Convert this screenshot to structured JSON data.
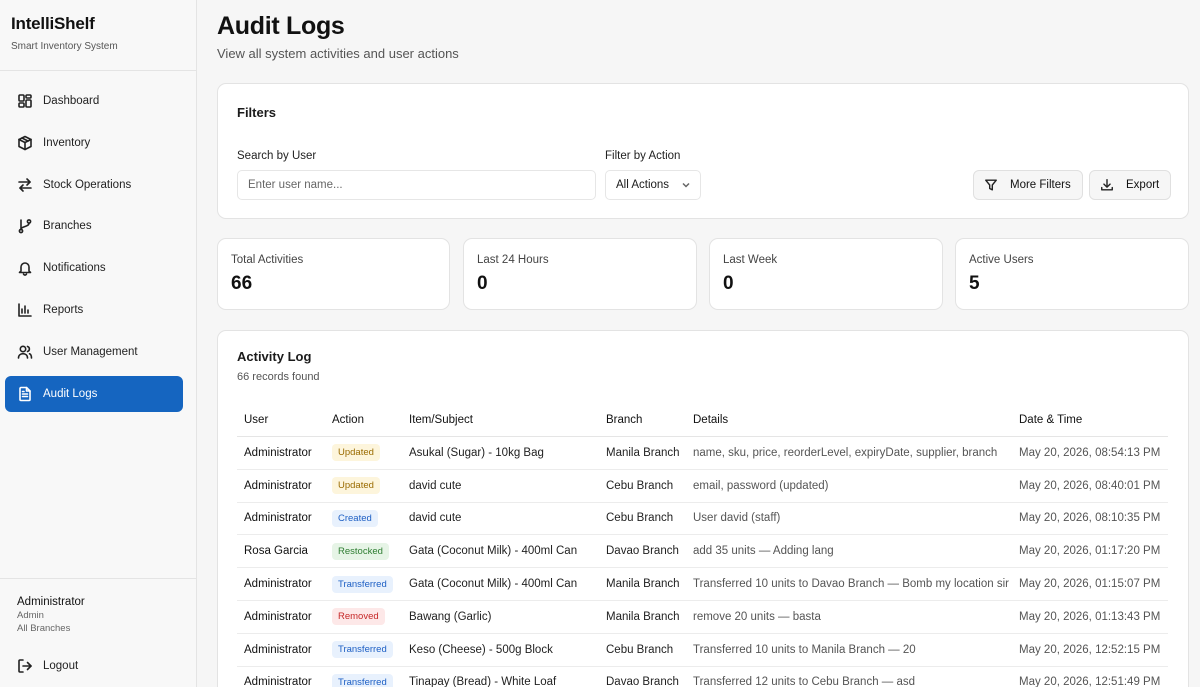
{
  "app": {
    "title": "IntelliShelf",
    "subtitle": "Smart Inventory System"
  },
  "sidebar": {
    "items": [
      {
        "label": "Dashboard",
        "icon": "dashboard-icon"
      },
      {
        "label": "Inventory",
        "icon": "box-icon"
      },
      {
        "label": "Stock Operations",
        "icon": "arrows-icon"
      },
      {
        "label": "Branches",
        "icon": "git-branch-icon"
      },
      {
        "label": "Notifications",
        "icon": "bell-icon"
      },
      {
        "label": "Reports",
        "icon": "bar-chart-icon"
      },
      {
        "label": "User Management",
        "icon": "users-icon"
      },
      {
        "label": "Audit Logs",
        "icon": "file-text-icon",
        "active": true
      }
    ],
    "user": {
      "name": "Administrator",
      "role": "Admin",
      "branch": "All Branches"
    },
    "logout_label": "Logout"
  },
  "header": {
    "title": "Audit Logs",
    "subtitle": "View all system activities and user actions"
  },
  "filters": {
    "title": "Filters",
    "search_label": "Search by User",
    "search_placeholder": "Enter user name...",
    "action_label": "Filter by Action",
    "action_value": "All Actions",
    "more_filters_label": "More Filters",
    "export_label": "Export"
  },
  "stats": [
    {
      "label": "Total Activities",
      "value": "66"
    },
    {
      "label": "Last 24 Hours",
      "value": "0"
    },
    {
      "label": "Last Week",
      "value": "0"
    },
    {
      "label": "Active Users",
      "value": "5"
    }
  ],
  "log": {
    "title": "Activity Log",
    "count": "66 records found",
    "columns": [
      "User",
      "Action",
      "Item/Subject",
      "Branch",
      "Details",
      "Date & Time"
    ],
    "rows": [
      {
        "user": "Administrator",
        "action": "Updated",
        "item": "Asukal (Sugar) - 10kg Bag",
        "branch": "Manila Branch",
        "details": "name, sku, price, reorderLevel, expiryDate, supplier, branch",
        "date": "May 20, 2026, 08:54:13 PM"
      },
      {
        "user": "Administrator",
        "action": "Updated",
        "item": "david cute",
        "branch": "Cebu Branch",
        "details": "email, password (updated)",
        "date": "May 20, 2026, 08:40:01 PM"
      },
      {
        "user": "Administrator",
        "action": "Created",
        "item": "david cute",
        "branch": "Cebu Branch",
        "details": "User david (staff)",
        "date": "May 20, 2026, 08:10:35 PM"
      },
      {
        "user": "Rosa Garcia",
        "action": "Restocked",
        "item": "Gata (Coconut Milk) - 400ml Can",
        "branch": "Davao Branch",
        "details": "add 35 units — Adding lang",
        "date": "May 20, 2026, 01:17:20 PM"
      },
      {
        "user": "Administrator",
        "action": "Transferred",
        "item": "Gata (Coconut Milk) - 400ml Can",
        "branch": "Manila Branch",
        "details": "Transferred 10 units to Davao Branch — Bomb my location sir",
        "date": "May 20, 2026, 01:15:07 PM"
      },
      {
        "user": "Administrator",
        "action": "Removed",
        "item": "Bawang (Garlic)",
        "branch": "Manila Branch",
        "details": "remove 20 units — basta",
        "date": "May 20, 2026, 01:13:43 PM"
      },
      {
        "user": "Administrator",
        "action": "Transferred",
        "item": "Keso (Cheese) - 500g Block",
        "branch": "Cebu Branch",
        "details": "Transferred 10 units to Manila Branch — 20",
        "date": "May 20, 2026, 12:52:15 PM"
      },
      {
        "user": "Administrator",
        "action": "Transferred",
        "item": "Tinapay (Bread) - White Loaf",
        "branch": "Davao Branch",
        "details": "Transferred 12 units to Cebu Branch — asd",
        "date": "May 20, 2026, 12:51:49 PM"
      }
    ]
  }
}
